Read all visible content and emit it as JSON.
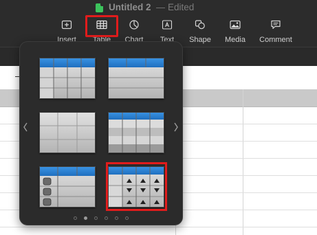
{
  "window": {
    "title": "Untitled 2",
    "separator": "—",
    "status": "Edited"
  },
  "toolbar": {
    "items": [
      {
        "label": "Insert",
        "icon": "insert-icon"
      },
      {
        "label": "Table",
        "icon": "table-icon"
      },
      {
        "label": "Chart",
        "icon": "chart-icon"
      },
      {
        "label": "Text",
        "icon": "text-icon"
      },
      {
        "label": "Shape",
        "icon": "shape-icon"
      },
      {
        "label": "Media",
        "icon": "media-icon"
      },
      {
        "label": "Comment",
        "icon": "comment-icon"
      }
    ]
  },
  "table_picker": {
    "styles": [
      {
        "name": "blue header table"
      },
      {
        "name": "blue header plain table"
      },
      {
        "name": "plain gray table"
      },
      {
        "name": "blue header gray rows table"
      },
      {
        "name": "checklist table"
      },
      {
        "name": "stepper table",
        "selected": true
      }
    ],
    "page_count": 6,
    "current_page": 2
  },
  "colors": {
    "header_blue": "#2f86d6",
    "highlight_red": "#e11c1c",
    "cell_gray": "#c8c8c8"
  }
}
